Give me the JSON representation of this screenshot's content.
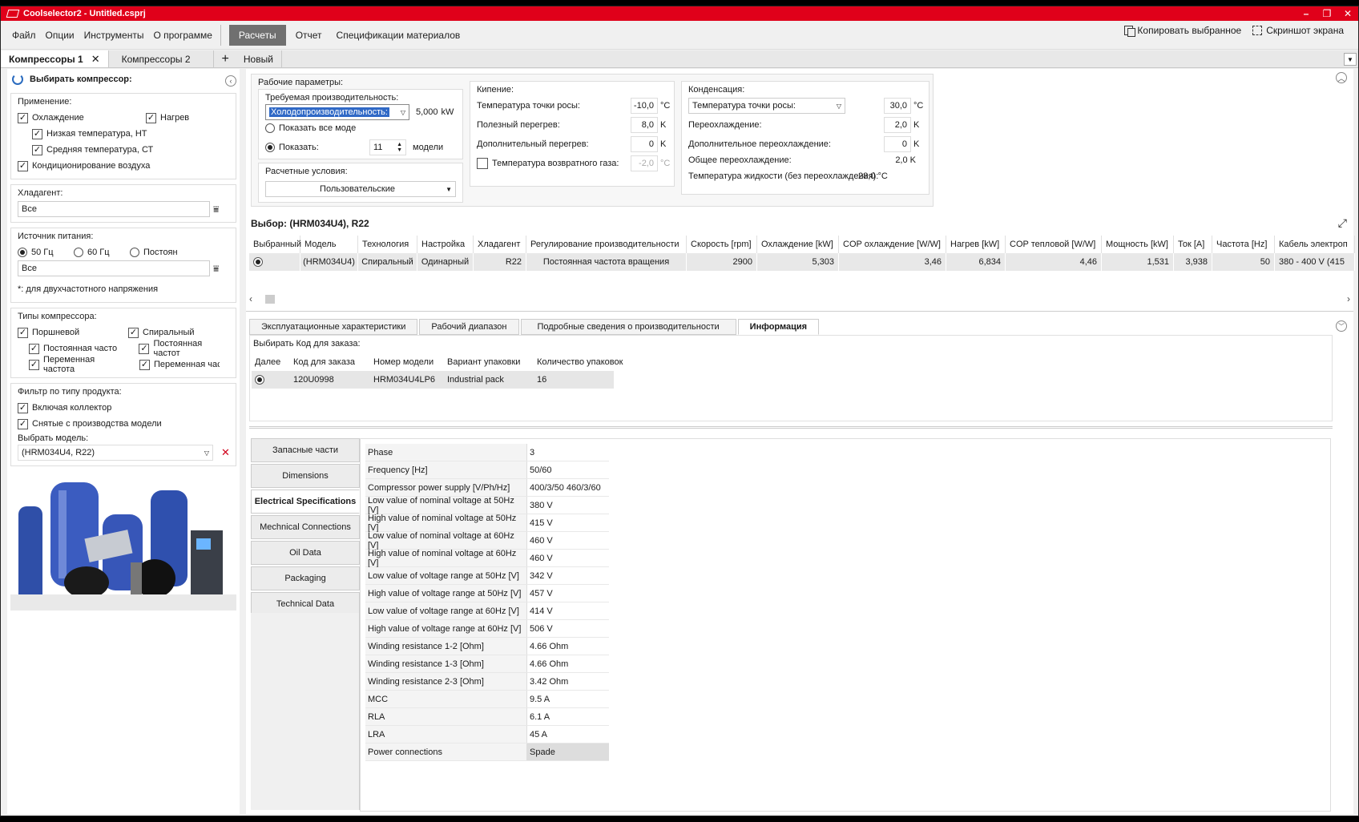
{
  "window": {
    "title": "Coolselector2 - Untitled.csprj",
    "controls": [
      "–",
      "❐",
      "✕"
    ]
  },
  "menu": {
    "items": [
      "Файл",
      "Опции",
      "Инструменты",
      "О программе"
    ],
    "active": "Расчеты",
    "after": [
      "Отчет",
      "Спецификации материалов"
    ],
    "copy_selected": "Копировать выбранное",
    "screenshot": "Скриншот экрана"
  },
  "tabs": {
    "tab1": "Компрессоры 1",
    "tab2": "Компрессоры 2",
    "new_tab": "Новый",
    "close_glyph": "✕",
    "plus_glyph": "+"
  },
  "left": {
    "header": "Выбирать компрессор:",
    "application": {
      "title": "Применение:",
      "cooling": "Охлаждение",
      "heating": "Нагрев",
      "low_temp": "Низкая температура, НТ",
      "medium_temp": "Средняя температура, СТ",
      "air_cond": "Кондиционирование воздуха"
    },
    "refrigerant": {
      "title": "Хладагент:",
      "value": "Все"
    },
    "power": {
      "title": "Источник питания:",
      "hz50": "50 Гц",
      "hz60": "60 Гц",
      "const": "Постоян",
      "value": "Все",
      "note": "*: для двухчастотного напряжения"
    },
    "types": {
      "title": "Типы компрессора:",
      "piston": "Поршневой",
      "scroll": "Спиральный",
      "piston_fixed": "Постоянная часто",
      "piston_var": "Переменная частота",
      "scroll_fixed": "Постоянная частот",
      "scroll_var": "Переменная частота"
    },
    "filter": {
      "title": "Фильтр по типу продукта:",
      "collector": "Включая коллектор",
      "discontinued": "Снятые с производства модели",
      "select_model_label": "Выбрать модель:",
      "selected_model": "(HRM034U4, R22)"
    }
  },
  "params": {
    "title": "Рабочие параметры:",
    "required_capacity": {
      "title": "Требуемая производительность:",
      "combo": "Холодопроизводительность:",
      "value": "5,000",
      "unit": "kW",
      "show_all": "Показать все моде",
      "show": "Показать:",
      "show_count": "11",
      "models": "модели"
    },
    "calc_conditions": {
      "title": "Расчетные условия:",
      "value": "Пользовательские"
    },
    "boiling": {
      "title": "Кипение:",
      "dew_temp": "Температура точки росы:",
      "dew_value": "-10,0",
      "dew_unit": "°C",
      "useful_sh": "Полезный перегрев:",
      "useful_sh_value": "8,0",
      "useful_sh_unit": "K",
      "extra_sh": "Дополнительный перегрев:",
      "extra_sh_value": "0",
      "extra_sh_unit": "K",
      "return_gas": "Температура возвратного газа:",
      "return_gas_value": "-2,0",
      "return_gas_unit": "°C"
    },
    "condensing": {
      "title": "Конденсация:",
      "combo": "Температура точки росы:",
      "value": "30,0",
      "unit": "°C",
      "subcool": "Переохлаждение:",
      "subcool_value": "2,0",
      "subcool_unit": "K",
      "extra_subcool": "Дополнительное переохлаждение:",
      "extra_subcool_value": "0",
      "extra_subcool_unit": "K",
      "total_subcool": "Общее переохлаждение:",
      "total_subcool_value": "2,0 K",
      "liquid_temp": "Температура жидкости (без переохлаждения):",
      "liquid_temp_value": "28,0 °C"
    }
  },
  "selection": {
    "title": "Выбор: (HRM034U4), R22",
    "headers": [
      "Выбранный",
      "Модель",
      "Технология",
      "Настройка",
      "Хладагент",
      "Регулирование производительности",
      "Скорость [rpm]",
      "Охлаждение [kW]",
      "COP охлаждение [W/W]",
      "Нагрев [kW]",
      "COP тепловой [W/W]",
      "Мощность [kW]",
      "Ток [A]",
      "Частота [Hz]",
      "Кабель электроп"
    ],
    "row": [
      "",
      "(HRM034U4)",
      "Спиральный",
      "Одинарный",
      "R22",
      "Постоянная частота вращения",
      "2900",
      "5,303",
      "3,46",
      "6,834",
      "4,46",
      "1,531",
      "3,938",
      "50",
      "380 - 400 V (415"
    ]
  },
  "subtabs": [
    "Эксплуатационные характеристики",
    "Рабочий диапазон",
    "Подробные сведения о производительности",
    "Информация"
  ],
  "order": {
    "title": "Выбирать Код для заказа:",
    "headers": [
      "Далее",
      "Код для заказа",
      "Номер модели",
      "Вариант упаковки",
      "Количество упаковок"
    ],
    "row": [
      "",
      "120U0998",
      "HRM034U4LP6",
      "Industrial pack",
      "16"
    ]
  },
  "side_buttons": [
    "Запасные части",
    "Dimensions",
    "Electrical Specifications",
    "Mechnical Connections",
    "Oil Data",
    "Packaging",
    "Technical Data"
  ],
  "specs": [
    [
      "Phase",
      "3"
    ],
    [
      "Frequency [Hz]",
      "50/60"
    ],
    [
      "Compressor power supply [V/Ph/Hz]",
      "400/3/50 460/3/60"
    ],
    [
      "Low value of nominal voltage at 50Hz [V]",
      "380 V"
    ],
    [
      "High value of nominal voltage at 50Hz [V]",
      "415 V"
    ],
    [
      "Low value of nominal voltage at 60Hz [V]",
      "460 V"
    ],
    [
      "High value of nominal voltage at 60Hz [V]",
      "460 V"
    ],
    [
      "Low value of voltage range at 50Hz [V]",
      "342 V"
    ],
    [
      "High value of voltage range at 50Hz [V]",
      "457 V"
    ],
    [
      "Low value of voltage range at 60Hz [V]",
      "414 V"
    ],
    [
      "High value of voltage range at 60Hz [V]",
      "506 V"
    ],
    [
      "Winding resistance 1-2 [Ohm]",
      "4.66 Ohm"
    ],
    [
      "Winding resistance 1-3 [Ohm]",
      "4.66 Ohm"
    ],
    [
      "Winding resistance 2-3 [Ohm]",
      "3.42 Ohm"
    ],
    [
      "MCC",
      "9.5 A"
    ],
    [
      "RLA",
      "6.1 A"
    ],
    [
      "LRA",
      "45 A"
    ],
    [
      "Power connections",
      "Spade"
    ]
  ],
  "colors": {
    "titlebar": "#e0001a",
    "accent": "#3069c6",
    "clear": "#d0021b"
  }
}
